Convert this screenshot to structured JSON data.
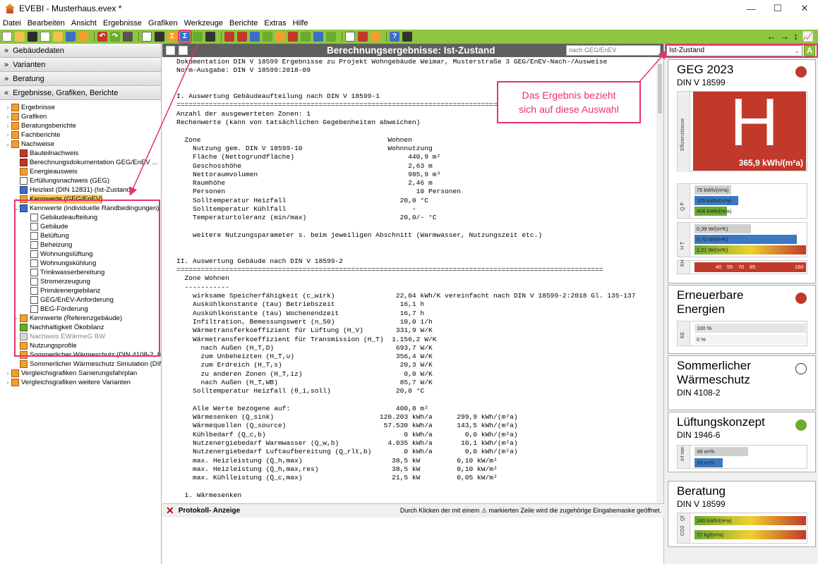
{
  "window": {
    "title": "EVEBI - Musterhaus.evex *",
    "controls": [
      "—",
      "☐",
      "✕"
    ]
  },
  "menu": [
    "Datei",
    "Bearbeiten",
    "Ansicht",
    "Ergebnisse",
    "Grafiken",
    "Werkzeuge",
    "Berichte",
    "Extras",
    "Hilfe"
  ],
  "colors": {
    "toolbar_green": "#8dc63f",
    "highlight_pink": "#e8336b",
    "rating_red": "#c0392b",
    "ok_green": "#6aaa2f"
  },
  "left": {
    "sections": [
      "Gebäudedaten",
      "Varianten",
      "Beratung",
      "Ergebnisse, Grafiken, Berichte"
    ],
    "tree": [
      {
        "label": "Ergebnisse"
      },
      {
        "label": "Grafiken"
      },
      {
        "label": "Beratungsberichte"
      },
      {
        "label": "Fachberichte"
      },
      {
        "label": "Nachweise"
      },
      {
        "label": "Bauteilnachweis"
      },
      {
        "label": "Berechnungsdokumentation GEG/EnEV ..."
      },
      {
        "label": "Energieausweis"
      },
      {
        "label": "Erfüllungsnachweis (GEG)"
      },
      {
        "label": "Heizlast (DIN 12831) (Ist-Zustand)"
      },
      {
        "label": "Kennwerte (GEG/EnEV)"
      },
      {
        "label": "Kennwerte (individuelle Randbedingungen)"
      },
      {
        "label": "Gebäudeaufteilung"
      },
      {
        "label": "Gebäude"
      },
      {
        "label": "Belüftung"
      },
      {
        "label": "Beheizung"
      },
      {
        "label": "Wohnungslüftung"
      },
      {
        "label": "Wohnungskühlung"
      },
      {
        "label": "Trinkwasserbereitung"
      },
      {
        "label": "Stromerzeugung"
      },
      {
        "label": "Primärenergiebilanz"
      },
      {
        "label": "GEG/EnEV-Anforderung"
      },
      {
        "label": "BEG-Förderung"
      },
      {
        "label": "Kennwerte (Referenzgebäude)"
      },
      {
        "label": "Nachhaltigkeit Ökobilanz"
      },
      {
        "label": "Nachweis EWärmeG BW"
      },
      {
        "label": "Nutzungsprofile"
      },
      {
        "label": "Sommerlicher Wärmeschutz (DIN 4108-2, 8"
      },
      {
        "label": "Sommerlicher Wärmeschutz Simulation (DIN"
      },
      {
        "label": "Vergleichsgrafiken Sanierungsfahrplan"
      },
      {
        "label": "Vergleichsgrafiken weitere Varianten"
      }
    ]
  },
  "center": {
    "title": "Berechnungsergebnisse: Ist-Zustand",
    "filter": "nach GEG/EnEV",
    "report": [
      "Dokumentation DIN V 18599 Ergebnisse zu Projekt Wohngebäude Weimar, Musterstraße 3 GEG/EnEV-Nach-/Ausweise",
      "Norm-Ausgabe: DIN V 18599:2018-09",
      "",
      "",
      "I. Auswertung Gebäudeaufteilung nach DIN V 18599-1",
      "=========================================================================================================",
      "Anzahl der ausgewerteten Zonen: 1",
      "Rechenwerte (kann von tatsächlichen Gegebenheiten abweichen)",
      "",
      "  Zone                                              Wohnen",
      "    Nutzung gem. DIN V 18599-10                     Wohnnutzung",
      "    Fläche (Nettogrundfläche)                            440,9 m²",
      "    Geschosshöhe                                         2,63 m",
      "    Nettoraumvolumen                                     985,9 m³",
      "    Raumhöhe                                             2,46 m",
      "    Personen                                               10 Personen",
      "    Solltemperatur Heizfall                            20,0 °C",
      "    Solltemperatur Kühlfall                               -",
      "    Temperaturtoleranz (min/max)                       20,0/- °C",
      "",
      "    weitere Nutzungsparameter s. beim jeweiligen Abschnitt (Warmwasser, Nutzungszeit etc.)",
      "",
      "",
      "II. Auswertung Gebäude nach DIN V 18599-2",
      "=========================================================================================================",
      "  Zone Wohnen",
      "  -----------",
      "    wirksame Speicherfähigkeit (c_wirk)               22,04 kWh/K vereinfacht nach DIN V 18599-2:2018 Gl. 135-137",
      "    Auskühlkonstante (tau) Betriebszeit                16,1 h",
      "    Auskühlkonstante (tau) Wochenendzeit               16,7 h",
      "    Infiltration, Bemessungswert (n_50)                10,0 1/h",
      "    Wärmetransferkoeffizient für Lüftung (H_V)        331,9 W/K",
      "    Wärmetransferkoeffizient für Transmission (H_T)  1.156,2 W/K",
      "      nach Außen (H_T,D)                              693,7 W/K",
      "      zum Unbeheizten (H_T,u)                         356,4 W/K",
      "      zum Erdreich (H_T,s)                             20,3 W/K",
      "      zu anderen Zonen (H_T,iz)                         0,0 W/K",
      "      nach Außen (H_T,WB)                              85,7 W/K",
      "    Solltemperatur Heizfall (θ_i,soll)                20,0 °C",
      "",
      "    Alle Werte bezogene auf:                          400,8 m²",
      "    Wärmesenken (Q_sink)                          120.203 kWh/a      299,9 kWh/(m²a)",
      "    Wärmequellen (Q_source)                        57.530 kWh/a      143,5 kWh/(m²a)",
      "    Kühlbedarf (Q_c,b)                                  0 kWh/a        0,0 kWh/(m²a)",
      "    Nutzenergiebedarf Warmwasser (Q_w,b)            4.035 kWh/a       10,1 kWh/(m²a)",
      "    Nutzenergiebedarf Luftaufbereitung (Q_rlt,b)        0 kWh/a        0,0 kWh/(m²a)",
      "    max. Heizleistung (Q̇_h,max)                      38,5 kW         0,10 kW/m²",
      "    max. Heizleistung (Q̇_h,max,res)                  38,5 kW         0,10 kW/m²",
      "    max. Kühlleistung (Q̇_c,max)                      21,5 kW         0,05 kW/m²",
      "",
      "  1. Wärmesenken"
    ],
    "protokoll_label": "Protokoll- Anzeige",
    "protokoll_hint": "Durch Klicken der mit einem ⚠ markierten Zeile wird die zugehörige Eingabemaske geöffnet.",
    "callout": [
      "Das Ergebnis bezieht",
      "sich auf diese Auswahl"
    ]
  },
  "right": {
    "variant": "Ist-Zustand",
    "variant_badge": "A",
    "geg": {
      "title": "GEG 2023",
      "subtitle": "DIN V 18599",
      "class_label": "Effizienzklasse",
      "class": "H",
      "value": "365,9 kWh/(m²a)",
      "status": "red"
    },
    "qp": {
      "label": "Q P",
      "bars": [
        {
          "text": "75 kWh/(m²a)",
          "color": "#cfcfcf",
          "fraction": 0.25
        },
        {
          "text": "105 kWh/(m²a)",
          "color": "#3b79c2",
          "fraction": 0.3
        },
        {
          "text": "406 kWh/(m²a)",
          "color": "#6aaa2f",
          "fraction": 0.22
        }
      ]
    },
    "ht": {
      "label": "H T",
      "bars": [
        {
          "text": "0,39 W/(m²K)",
          "color": "#cfcfcf",
          "fraction": 0.5
        },
        {
          "text": "0,70 W/(m²K)",
          "color": "#3b79c2",
          "fraction": 0.92
        },
        {
          "text": "1,21 W/(m²K)",
          "color": "gradient",
          "fraction": 1.0
        }
      ]
    },
    "eh": {
      "label": "EH",
      "ticks": [
        "40",
        "55",
        "70",
        "85",
        "160"
      ]
    },
    "ee": {
      "title_1": "Erneuerbare",
      "title_2": "Energien",
      "status": "red",
      "label": "EE",
      "bars": [
        {
          "text": "100 %",
          "fraction": 1.0
        },
        {
          "text": "0 %",
          "fraction": 0.0
        }
      ]
    },
    "sw": {
      "title_1": "Sommerlicher",
      "title_2": "Wärmeschutz",
      "subtitle": "DIN 4108-2",
      "status": "empty"
    },
    "lk": {
      "title": "Lüftungskonzept",
      "subtitle": "DIN 1946-6",
      "status": "green",
      "label": "inf min",
      "bars": [
        {
          "text": "39 m³/h",
          "color": "#cfcfcf",
          "fraction": 0.48
        },
        {
          "text": "20 m³/h",
          "color": "#3b79c2",
          "fraction": 0.24
        }
      ]
    },
    "beratung": {
      "title": "Beratung",
      "subtitle": "DIN V 18599",
      "bars": [
        {
          "label": "Qf",
          "text": "240 kWh/(m²a)"
        },
        {
          "label": "CO2",
          "text": "72 kg/(m²a)"
        }
      ]
    }
  }
}
